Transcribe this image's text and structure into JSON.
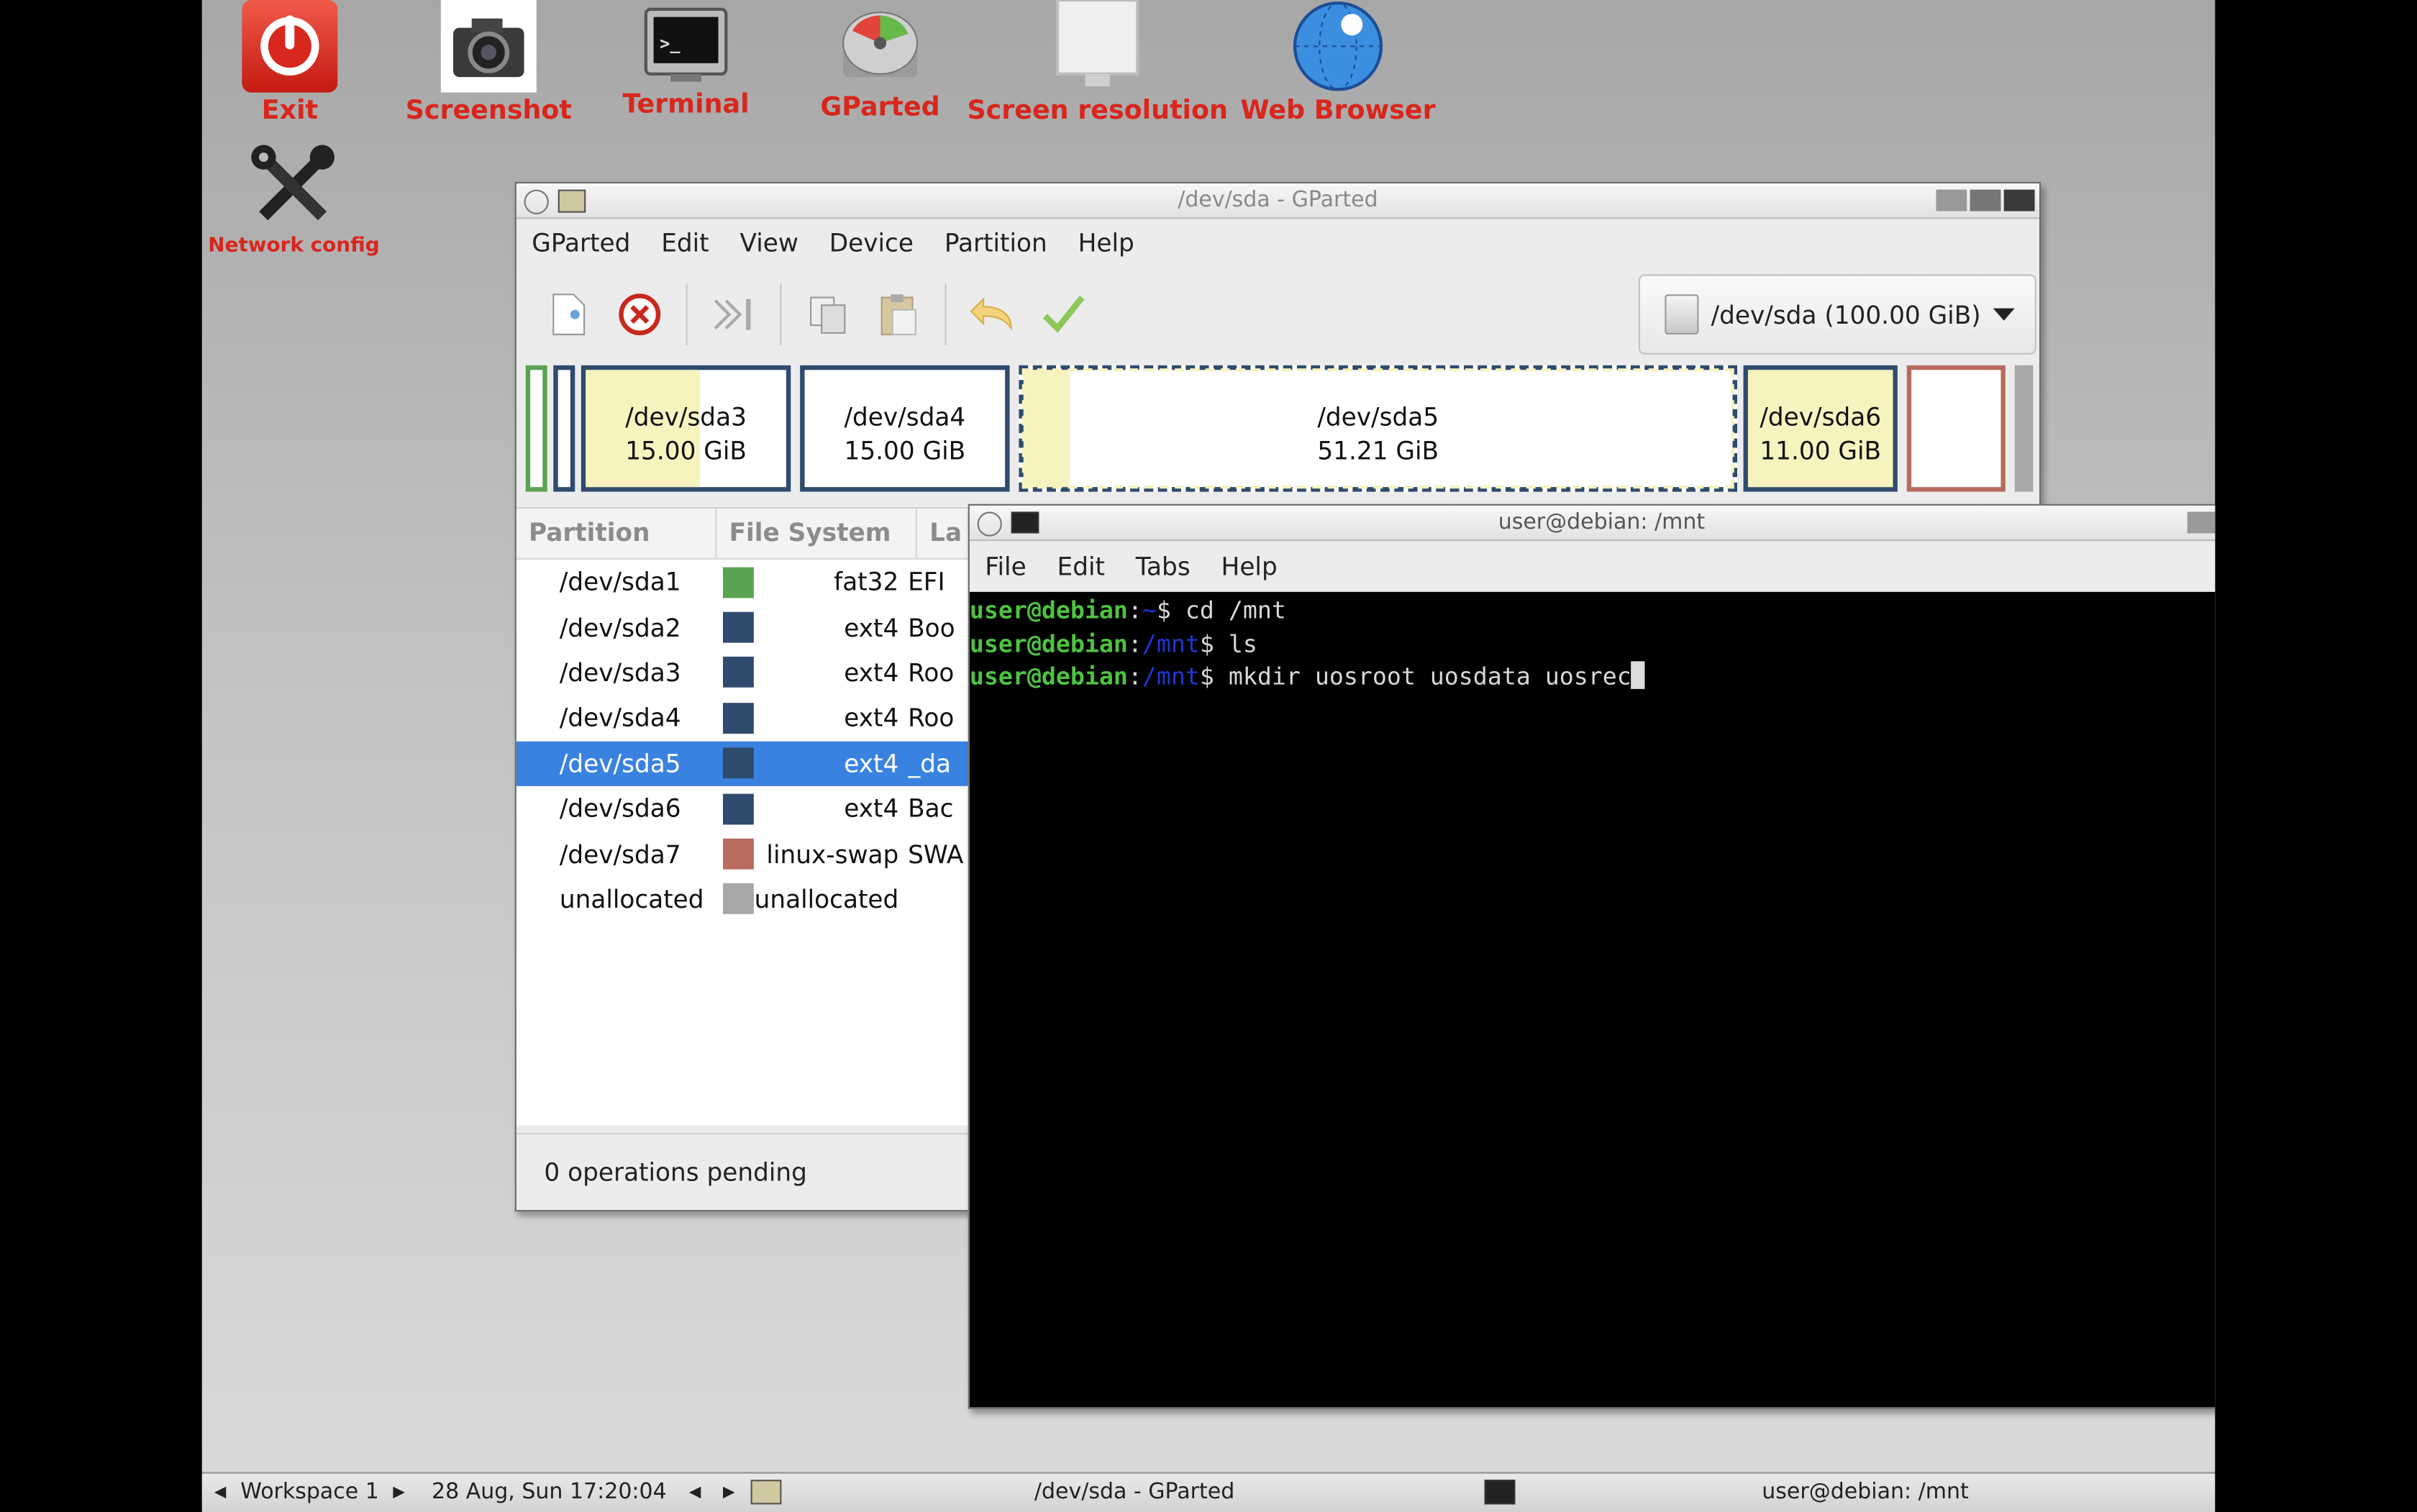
{
  "desktop": {
    "icons": [
      {
        "label": "Exit",
        "icon": "power-icon"
      },
      {
        "label": "Screenshot",
        "icon": "camera-icon"
      },
      {
        "label": "Terminal",
        "icon": "terminal-icon"
      },
      {
        "label": "GParted",
        "icon": "disk-icon"
      },
      {
        "label": "Screen resolution",
        "icon": "monitor-icon"
      },
      {
        "label": "Web Browser",
        "icon": "globe-icon"
      },
      {
        "label": "Network config",
        "icon": "tools-icon"
      }
    ]
  },
  "gparted": {
    "title": "/dev/sda - GParted",
    "menu": [
      "GParted",
      "Edit",
      "View",
      "Device",
      "Partition",
      "Help"
    ],
    "toolbar": [
      "new-partition-icon",
      "delete-icon",
      "resize-move-icon",
      "copy-icon",
      "paste-icon",
      "undo-icon",
      "apply-icon"
    ],
    "device": "/dev/sda (100.00 GiB)",
    "map": [
      {
        "name": "/dev/sda3",
        "size": "15.00 GiB"
      },
      {
        "name": "/dev/sda4",
        "size": "15.00 GiB"
      },
      {
        "name": "/dev/sda5",
        "size": "51.21 GiB"
      },
      {
        "name": "/dev/sda6",
        "size": "11.00 GiB"
      }
    ],
    "columns": [
      "Partition",
      "File System",
      "La"
    ],
    "rows": [
      {
        "partition": "/dev/sda1",
        "fs": "fat32",
        "label": "EFI",
        "color": "#5aa352"
      },
      {
        "partition": "/dev/sda2",
        "fs": "ext4",
        "label": "Boo",
        "color": "#2f4b6e"
      },
      {
        "partition": "/dev/sda3",
        "fs": "ext4",
        "label": "Roo",
        "color": "#2f4b6e"
      },
      {
        "partition": "/dev/sda4",
        "fs": "ext4",
        "label": "Roo",
        "color": "#2f4b6e"
      },
      {
        "partition": "/dev/sda5",
        "fs": "ext4",
        "label": "_da",
        "color": "#2f4b6e",
        "selected": true
      },
      {
        "partition": "/dev/sda6",
        "fs": "ext4",
        "label": "Bac",
        "color": "#2f4b6e"
      },
      {
        "partition": "/dev/sda7",
        "fs": "linux-swap",
        "label": "SWA",
        "color": "#b86b5e"
      },
      {
        "partition": "unallocated",
        "fs": "unallocated",
        "label": "",
        "color": "#a8a8a8"
      }
    ],
    "status": "0 operations pending"
  },
  "terminal": {
    "title": "user@debian: /mnt",
    "menu": [
      "File",
      "Edit",
      "Tabs",
      "Help"
    ],
    "lines": [
      {
        "user": "user@debian",
        "dir": "~",
        "cmd": "cd /mnt"
      },
      {
        "user": "user@debian",
        "dir": "/mnt",
        "cmd": "ls"
      },
      {
        "user": "user@debian",
        "dir": "/mnt",
        "cmd": "mkdir uosroot uosdata uosrec"
      }
    ]
  },
  "taskbar": {
    "workspace": "Workspace 1",
    "clock": "28 Aug, Sun 17:20:04",
    "tasks": [
      "/dev/sda - GParted",
      "user@debian: /mnt"
    ]
  }
}
